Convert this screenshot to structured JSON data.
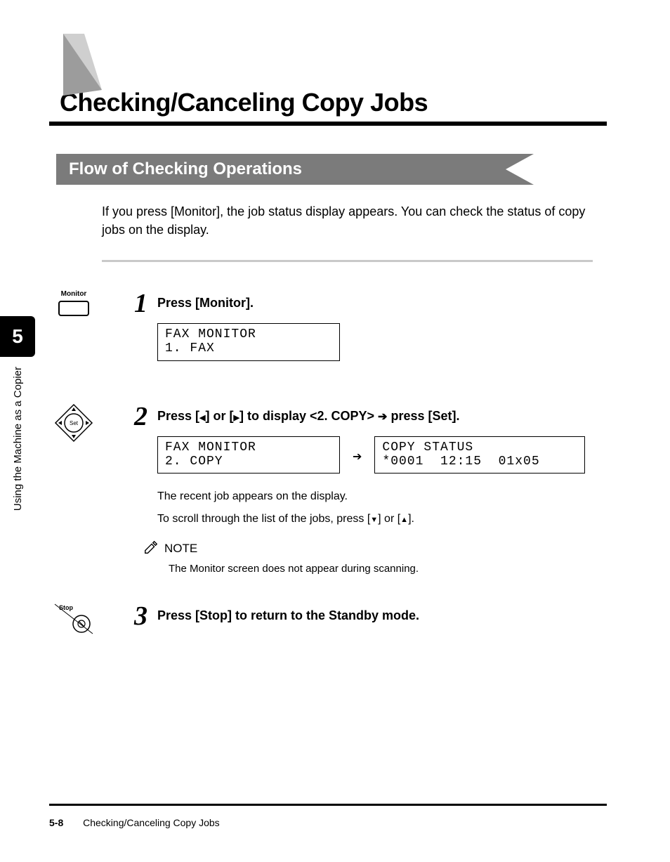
{
  "sidebar": {
    "chapter_num": "5",
    "chapter_label": "Using the Machine as a Copier"
  },
  "title": "Checking/Canceling Copy Jobs",
  "section": {
    "heading": "Flow of Checking Operations"
  },
  "intro": "If you press [Monitor], the job status display appears. You can check the status of copy jobs on the display.",
  "step1": {
    "icon_label": "Monitor",
    "num": "1",
    "heading": "Press [Monitor].",
    "lcd1": "FAX MONITOR\n1. FAX"
  },
  "step2": {
    "num": "2",
    "heading_pre": "Press [",
    "heading_mid1": "] or [",
    "heading_mid2": "] to display <2. COPY> ",
    "heading_post": " press [Set].",
    "lcd1": "FAX MONITOR\n2. COPY",
    "lcd2": "COPY STATUS\n*0001  12:15  01x05",
    "body1": "The recent job appears on the display.",
    "body2_pre": "To scroll through the list of the jobs, press [",
    "body2_mid": "] or [",
    "body2_post": "].",
    "note_label": "NOTE",
    "note_text": "The Monitor screen does not appear during scanning."
  },
  "step3": {
    "icon_label": "Stop",
    "num": "3",
    "heading": "Press [Stop] to return to the Standby mode."
  },
  "footer": {
    "page": "5-8",
    "title": "Checking/Canceling Copy Jobs"
  }
}
